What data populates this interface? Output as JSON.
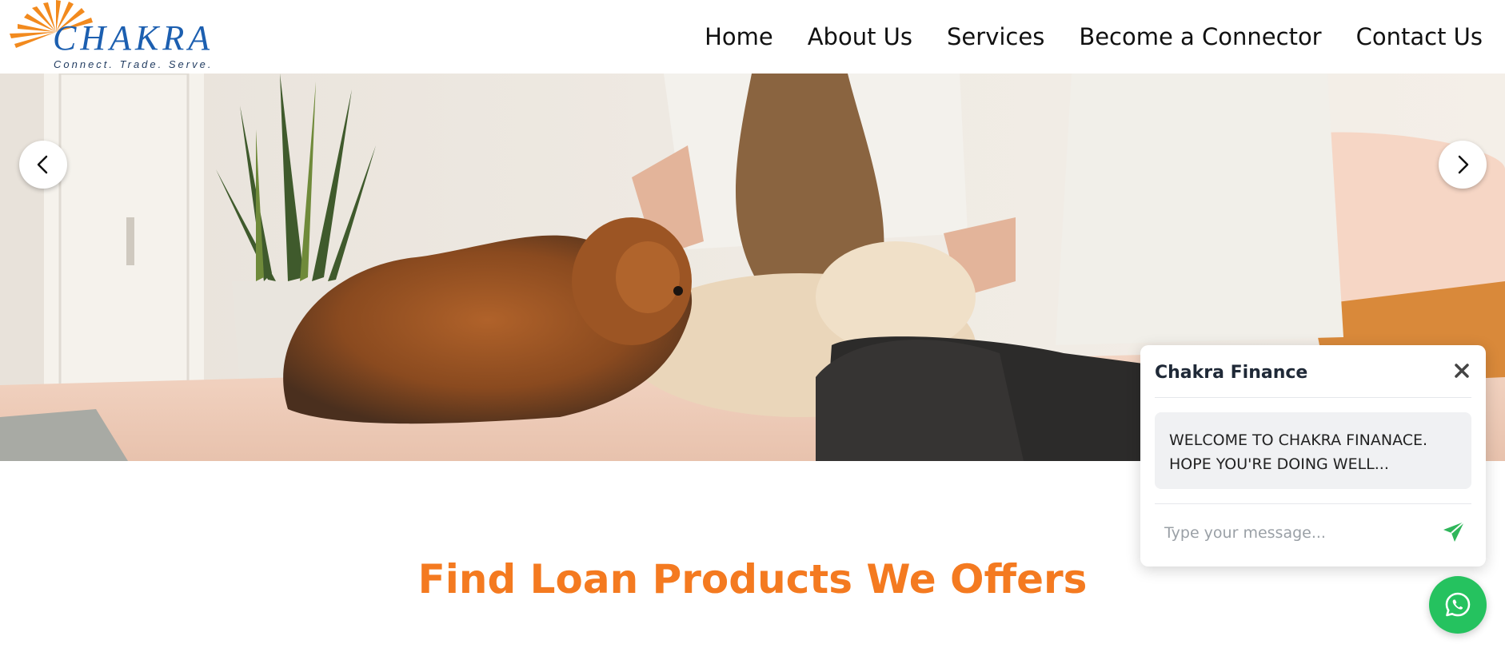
{
  "brand": {
    "name": "CHAKRA",
    "tagline": "Connect. Trade. Serve."
  },
  "nav": {
    "items": [
      {
        "label": "Home"
      },
      {
        "label": "About Us"
      },
      {
        "label": "Services"
      },
      {
        "label": "Become a Connector"
      },
      {
        "label": "Contact Us"
      }
    ]
  },
  "hero": {
    "image_alt": "two people sitting on a bed with dogs",
    "prev_icon": "chevron-left-icon",
    "next_icon": "chevron-right-icon"
  },
  "section": {
    "title": "Find Loan Products We Offers"
  },
  "chat": {
    "title": "Chakra Finance",
    "welcome_line1": "WELCOME TO CHAKRA FINANACE.",
    "welcome_line2": "HOPE YOU'RE DOING WELL...",
    "input_placeholder": "Type your message...",
    "close_icon": "close-icon",
    "send_icon": "send-icon"
  },
  "fab": {
    "icon": "whatsapp-icon"
  },
  "colors": {
    "accent_orange": "#f47a20",
    "brand_blue": "#1c5fb0",
    "whatsapp_green": "#25c25f"
  }
}
